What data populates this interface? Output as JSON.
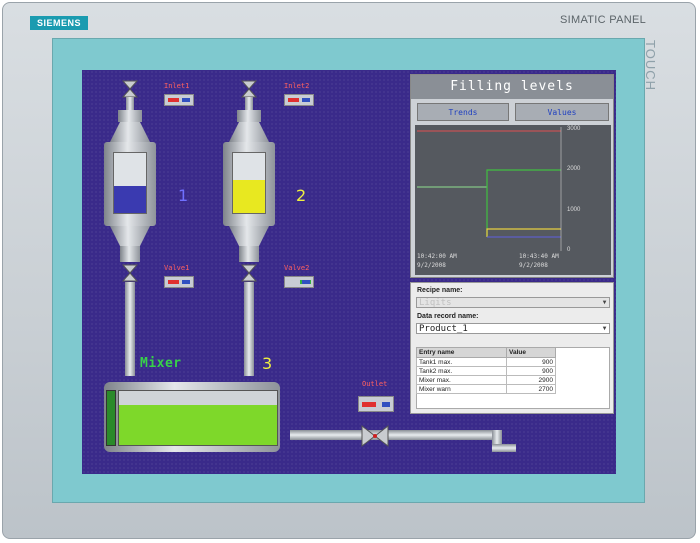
{
  "device": {
    "brand": "SIEMENS",
    "model": "SIMATIC PANEL",
    "touch": "TOUCH"
  },
  "process": {
    "inlet1": "Inlet1",
    "inlet2": "Inlet2",
    "valve1": "Valve1",
    "valve2": "Valve2",
    "outlet": "Outlet",
    "tank1_number": "1",
    "tank2_number": "2",
    "mixer_number": "3",
    "mixer_label": "Mixer",
    "tank1_fill_fraction": 0.45,
    "tank2_fill_fraction": 0.55,
    "mixer_fill_fraction": 0.75,
    "colors": {
      "tank1": "#3a3ab0",
      "tank2": "#e8e820",
      "mixer": "#7ed82a"
    }
  },
  "trend_panel": {
    "title": "Filling levels",
    "tab_trends": "Trends",
    "tab_values": "Values",
    "y_ticks": [
      "3000",
      "2000",
      "1000",
      "0"
    ],
    "time_left": "10:42:00 AM",
    "date_left": "9/2/2008",
    "time_right": "10:43:40 AM",
    "date_right": "9/2/2008"
  },
  "recipe": {
    "recipe_name_label": "Recipe name:",
    "recipe_name_value": "Liqits",
    "record_name_label": "Data record name:",
    "record_name_value": "Product_1",
    "col_entry": "Entry name",
    "col_value": "Value",
    "rows": [
      {
        "name": "Tank1 max.",
        "value": "900"
      },
      {
        "name": "Tank2 max.",
        "value": "900"
      },
      {
        "name": "Mixer max.",
        "value": "2900"
      },
      {
        "name": "Mixer warn",
        "value": "2700"
      }
    ]
  }
}
